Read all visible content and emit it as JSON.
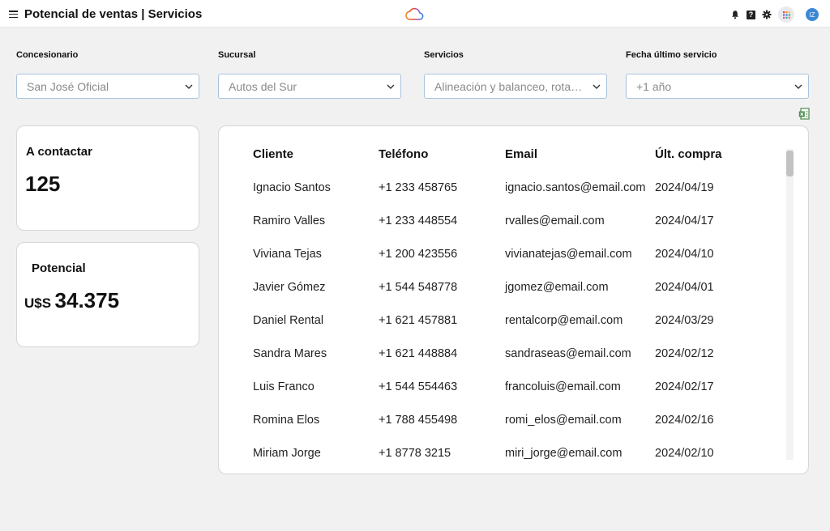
{
  "header": {
    "title": "Potencial de ventas | Servicios",
    "icons": [
      "menu-icon",
      "cloud-logo-icon",
      "bell-icon",
      "help-icon",
      "gear-icon",
      "apps-icon",
      "avatar"
    ],
    "help_glyph": "?",
    "avatar_initials": "IZ"
  },
  "filters": [
    {
      "label": "Concesionario",
      "value": "San José Oficial"
    },
    {
      "label": "Sucursal",
      "value": "Autos del Sur"
    },
    {
      "label": "Servicios",
      "value": "Alineación y balanceo, rotación..."
    },
    {
      "label": "Fecha último servicio",
      "value": "+1 año"
    }
  ],
  "cards": {
    "contact": {
      "title": "A contactar",
      "value": "125"
    },
    "potential": {
      "title": "Potencial",
      "currency": "U$S",
      "value": "34.375"
    }
  },
  "table": {
    "columns": [
      "Cliente",
      "Teléfono",
      "Email",
      "Últ. compra"
    ],
    "rows": [
      [
        "Ignacio Santos",
        "+1 233 458765",
        "ignacio.santos@email.com",
        "2024/04/19"
      ],
      [
        "Ramiro Valles",
        "+1 233 448554",
        "rvalles@email.com",
        "2024/04/17"
      ],
      [
        "Viviana Tejas",
        "+1 200 423556",
        "vivianatejas@email.com",
        "2024/04/10"
      ],
      [
        "Javier Gómez",
        "+1 544 548778",
        "jgomez@email.com",
        "2024/04/01"
      ],
      [
        "Daniel Rental",
        "+1 621 457881",
        "rentalcorp@email.com",
        "2024/03/29"
      ],
      [
        "Sandra Mares",
        "+1 621 448884",
        "sandraseas@email.com",
        "2024/02/12"
      ],
      [
        "Luis Franco",
        "+1 544 554463",
        "francoluis@email.com",
        "2024/02/17"
      ],
      [
        "Romina Elos",
        "+1 788 455498",
        "romi_elos@email.com",
        "2024/02/16"
      ],
      [
        "Miriam Jorge",
        "+1 8778 3215",
        "miri_jorge@email.com",
        "2024/02/10"
      ]
    ]
  },
  "colors": {
    "select_border": "#a9c3dc",
    "avatar": "#3b86d6",
    "export_icon": "#4a8a4a"
  }
}
